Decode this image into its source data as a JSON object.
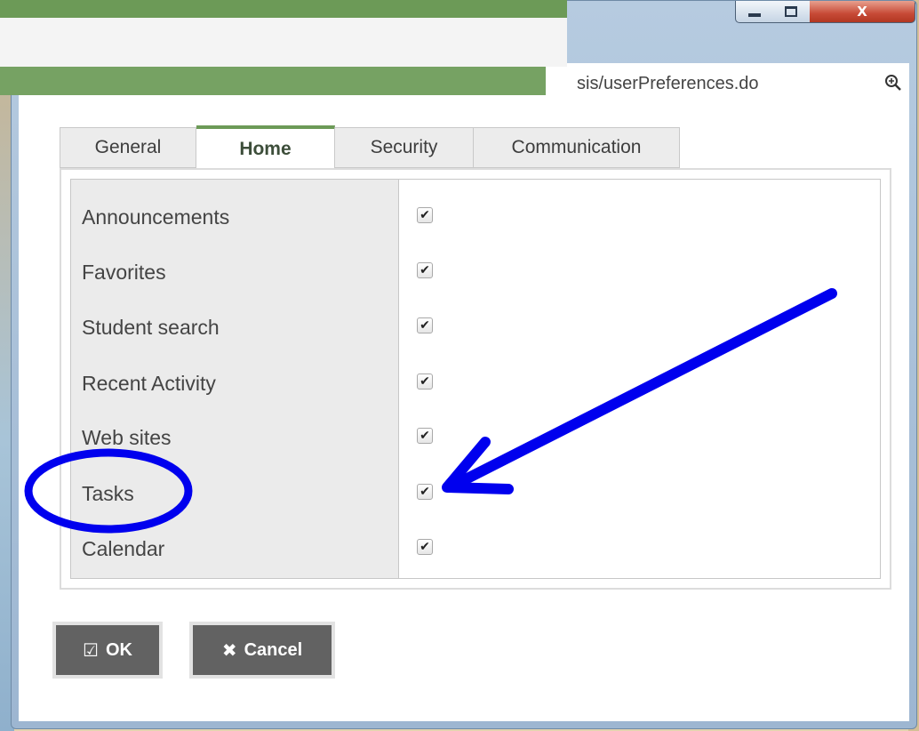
{
  "window": {
    "close_glyph": "X",
    "url_partial": "sis/userPreferences.do",
    "zoom_icon": "zoom-icon"
  },
  "tabs": [
    {
      "label": "General",
      "active": false
    },
    {
      "label": "Home",
      "active": true
    },
    {
      "label": "Security",
      "active": false
    },
    {
      "label": "Communication",
      "active": false
    }
  ],
  "home_widgets": [
    {
      "label": "Announcements",
      "checked": true
    },
    {
      "label": "Favorites",
      "checked": true
    },
    {
      "label": "Student search",
      "checked": true
    },
    {
      "label": "Recent Activity",
      "checked": true
    },
    {
      "label": "Web sites",
      "checked": true
    },
    {
      "label": "Tasks",
      "checked": true
    },
    {
      "label": "Calendar",
      "checked": true
    }
  ],
  "buttons": {
    "ok_label": "OK",
    "cancel_label": "Cancel"
  },
  "colors": {
    "accent_green": "#6c9a57",
    "annotation_blue": "#0000ee"
  }
}
